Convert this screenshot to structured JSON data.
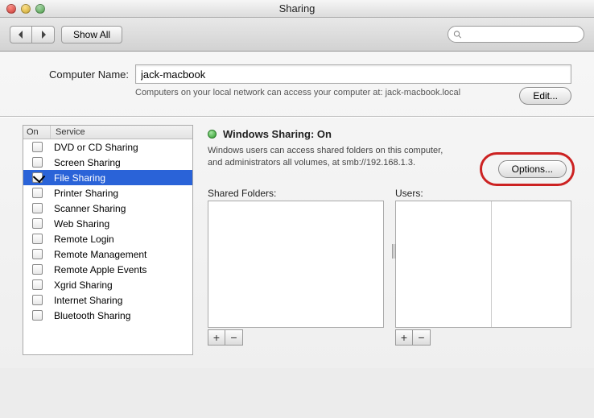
{
  "window": {
    "title": "Sharing"
  },
  "toolbar": {
    "show_all": "Show All",
    "search_placeholder": ""
  },
  "computer": {
    "label": "Computer Name:",
    "value": "jack-macbook",
    "hint": "Computers on your local network can access your computer at: jack-macbook.local",
    "edit": "Edit..."
  },
  "services": {
    "col_on": "On",
    "col_service": "Service",
    "items": [
      {
        "label": "DVD or CD Sharing",
        "on": false,
        "selected": false
      },
      {
        "label": "Screen Sharing",
        "on": false,
        "selected": false
      },
      {
        "label": "File Sharing",
        "on": true,
        "selected": true
      },
      {
        "label": "Printer Sharing",
        "on": false,
        "selected": false
      },
      {
        "label": "Scanner Sharing",
        "on": false,
        "selected": false
      },
      {
        "label": "Web Sharing",
        "on": false,
        "selected": false
      },
      {
        "label": "Remote Login",
        "on": false,
        "selected": false
      },
      {
        "label": "Remote Management",
        "on": false,
        "selected": false
      },
      {
        "label": "Remote Apple Events",
        "on": false,
        "selected": false
      },
      {
        "label": "Xgrid Sharing",
        "on": false,
        "selected": false
      },
      {
        "label": "Internet Sharing",
        "on": false,
        "selected": false
      },
      {
        "label": "Bluetooth Sharing",
        "on": false,
        "selected": false
      }
    ]
  },
  "detail": {
    "status": "Windows Sharing: On",
    "desc": "Windows users can access shared folders on this computer, and administrators all volumes, at smb://192.168.1.3.",
    "options": "Options...",
    "shared_label": "Shared Folders:",
    "users_label": "Users:",
    "plus": "+",
    "minus": "−"
  }
}
